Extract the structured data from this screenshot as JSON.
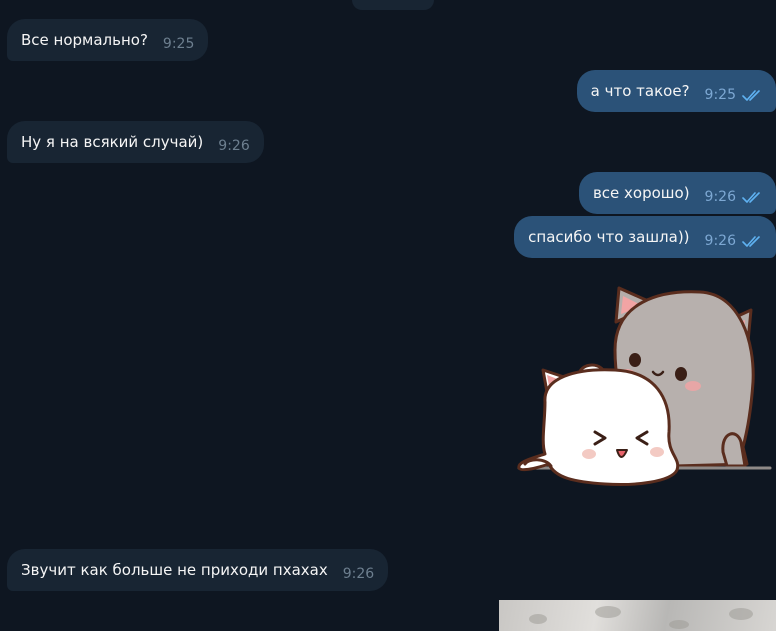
{
  "colors": {
    "background": "#0e1621",
    "incoming_bubble": "#182533",
    "outgoing_bubble": "#2b5278",
    "read_checks": "#5fb2f2"
  },
  "messages": [
    {
      "direction": "in",
      "text": "Все нормально?",
      "time": "9:25"
    },
    {
      "direction": "out",
      "text": "а что такое?",
      "time": "9:25",
      "status": "read"
    },
    {
      "direction": "in",
      "text": "Ну я на всякий случай)",
      "time": "9:26"
    },
    {
      "direction": "out",
      "text": "все хорошо)",
      "time": "9:26",
      "status": "read"
    },
    {
      "direction": "out",
      "text": "спасибо что зашла))",
      "time": "9:26",
      "status": "read"
    },
    {
      "direction": "in",
      "text": "Звучит как больше не приходи пхахах",
      "time": "9:26"
    }
  ],
  "sticker": {
    "icon": "cats-hug-sticker-icon",
    "description_visible": false
  },
  "attachment": {
    "icon": "photo-thumbnail-icon"
  }
}
